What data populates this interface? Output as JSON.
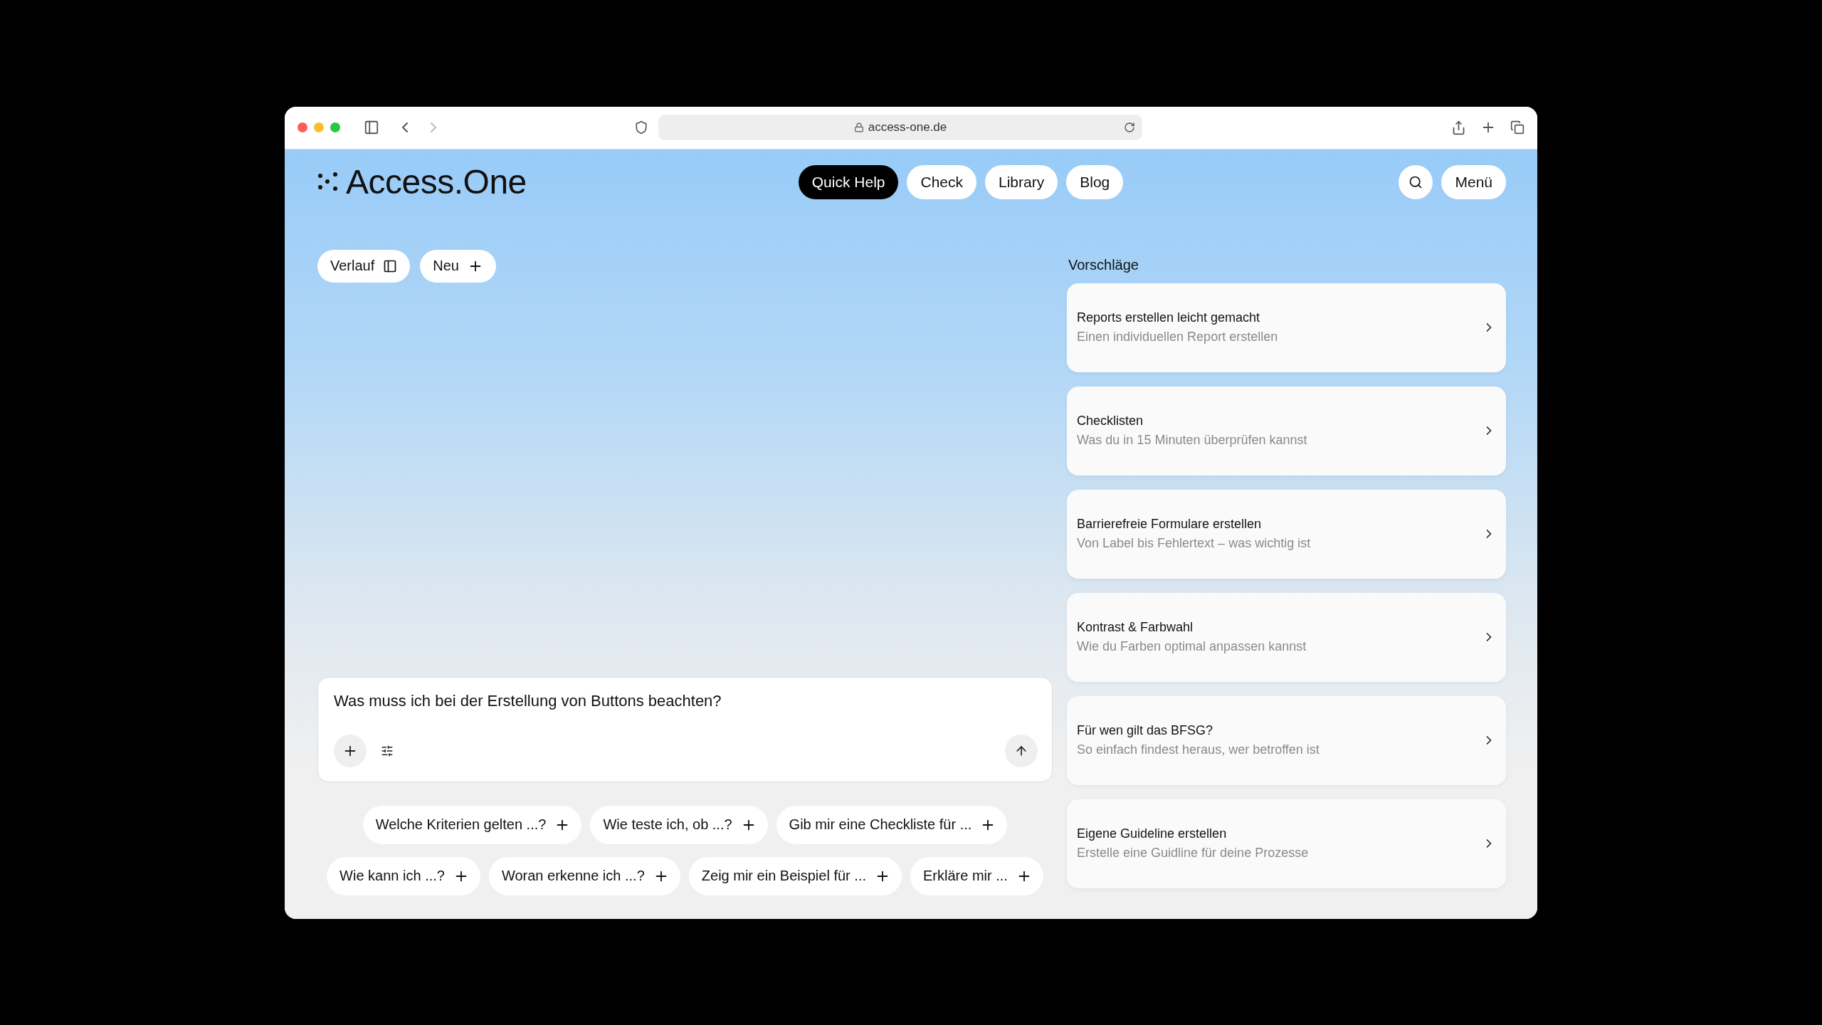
{
  "browser": {
    "url": "access-one.de"
  },
  "header": {
    "logo": "Access.One",
    "nav": [
      {
        "label": "Quick Help",
        "selected": true
      },
      {
        "label": "Check",
        "selected": false
      },
      {
        "label": "Library",
        "selected": false
      },
      {
        "label": "Blog",
        "selected": false
      }
    ],
    "menu_button": "Menü"
  },
  "chat": {
    "history_button": "Verlauf",
    "new_button": "Neu",
    "composer": {
      "value": "Was muss ich bei der Erstellung von Buttons beachten?"
    },
    "prompt_chip_rows": [
      {
        "chips": [
          "Welche Kriterien gelten ...?",
          "Wie teste ich, ob ...?",
          "Gib mir eine Checkliste für ..."
        ]
      },
      {
        "chips": [
          "Wie kann ich ...?",
          "Woran erkenne ich ...?",
          "Zeig mir ein Beispiel für ...",
          "Erkläre mir ..."
        ]
      }
    ]
  },
  "suggestions": {
    "title": "Vorschläge",
    "items": [
      {
        "title": "Reports erstellen leicht gemacht",
        "subtitle": "Einen individuellen Report erstellen"
      },
      {
        "title": "Checklisten",
        "subtitle": "Was du in 15 Minuten überprüfen kannst"
      },
      {
        "title": "Barrierefreie Formulare erstellen",
        "subtitle": "Von Label bis Fehlertext – was wichtig ist"
      },
      {
        "title": "Kontrast & Farbwahl",
        "subtitle": "Wie du Farben optimal anpassen kannst"
      },
      {
        "title": "Für wen gilt das BFSG?",
        "subtitle": "So einfach findest heraus, wer betroffen ist"
      },
      {
        "title": "Eigene Guideline erstellen",
        "subtitle": "Erstelle eine Guidline für deine Prozesse"
      }
    ]
  }
}
